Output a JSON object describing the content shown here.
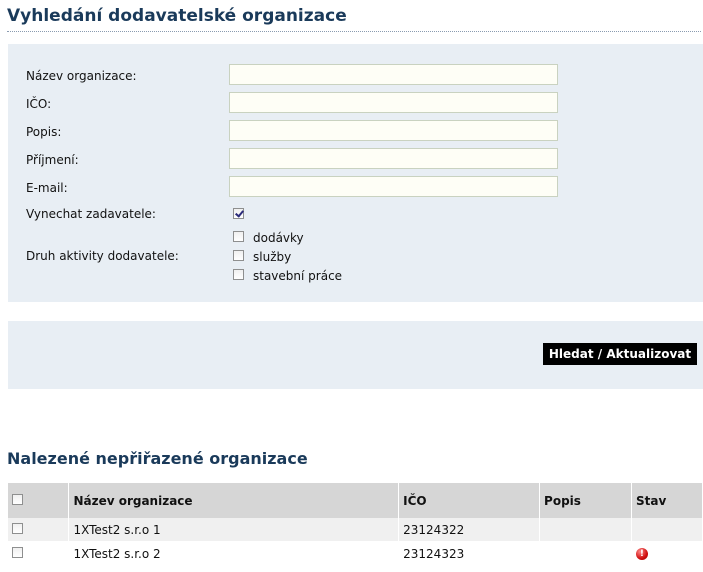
{
  "page_title": "Vyhledání dodavatelské organizace",
  "form": {
    "fields": [
      {
        "label": "Název organizace:",
        "value": ""
      },
      {
        "label": "IČO:",
        "value": ""
      },
      {
        "label": "Popis:",
        "value": ""
      },
      {
        "label": "Příjmení:",
        "value": ""
      },
      {
        "label": "E-mail:",
        "value": ""
      }
    ],
    "exclude_submitters": {
      "label": "Vynechat zadavatele:",
      "checked": true
    },
    "activity": {
      "label": "Druh aktivity dodavatele:",
      "options": [
        {
          "label": "dodávky",
          "checked": false
        },
        {
          "label": "služby",
          "checked": false
        },
        {
          "label": "stavební práce",
          "checked": false
        }
      ]
    }
  },
  "search_button_label": "Hledat / Aktualizovat",
  "results": {
    "title": "Nalezené nepřiřazené organizace",
    "columns": [
      "Název organizace",
      "IČO",
      "Popis",
      "Stav"
    ],
    "rows": [
      {
        "name": "1XTest2 s.r.o 1",
        "ico": "23124322",
        "description": "",
        "status_icon": ""
      },
      {
        "name": "1XTest2 s.r.o 2",
        "ico": "23124323",
        "description": "",
        "status_icon": "warning-icon"
      }
    ]
  },
  "colors": {
    "title": "#1a3a5a",
    "panel_bg": "#e8eef4",
    "button_bg": "#000000",
    "warning": "#d01010"
  }
}
